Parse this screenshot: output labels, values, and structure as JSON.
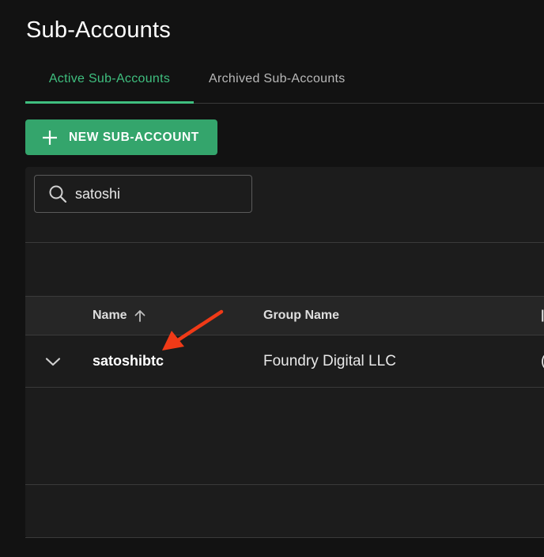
{
  "page": {
    "title": "Sub-Accounts"
  },
  "tabs": [
    {
      "label": "Active Sub-Accounts",
      "active": true
    },
    {
      "label": "Archived Sub-Accounts",
      "active": false
    }
  ],
  "toolbar": {
    "new_button_label": "NEW SUB-ACCOUNT"
  },
  "search": {
    "value": "satoshi",
    "icon": "search-icon"
  },
  "table": {
    "columns": [
      "Name",
      "Group Name"
    ],
    "sort": {
      "column": "Name",
      "direction": "ascending"
    },
    "rows": [
      {
        "name": "satoshibtc",
        "group_name": "Foundry Digital LLC"
      }
    ]
  },
  "colors": {
    "accent": "#3fbf7f",
    "button": "#34a56c",
    "background": "#121212",
    "panel": "#1c1c1c",
    "annotation_arrow": "#f03a17"
  }
}
